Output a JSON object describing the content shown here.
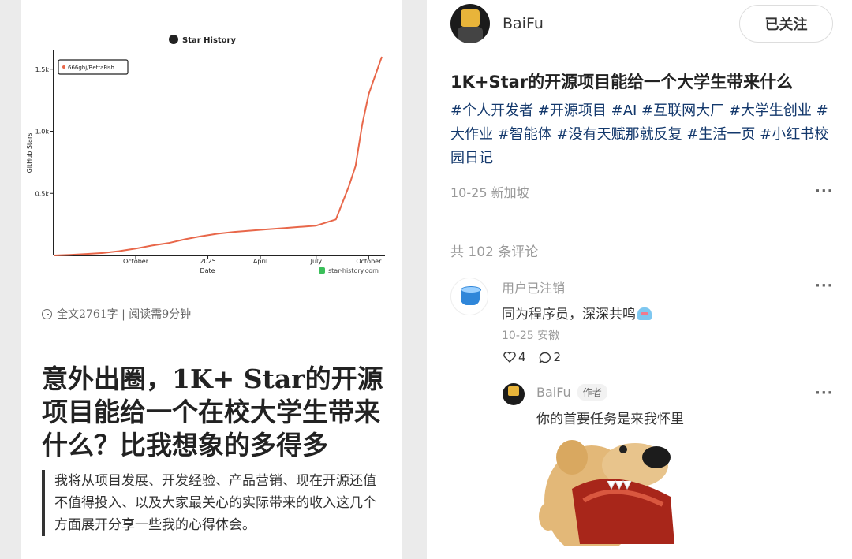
{
  "article": {
    "meta": "全文2761字 | 阅读需9分钟",
    "title": "意外出圈，1K+ Star的开源项目能给一个在校大学生带来什么？比我想象的多得多",
    "quote": "我将从项目发展、开发经验、产品营销、现在开源还值不值得投入、以及大家最关心的实际带来的收入这几个方面展开分享一些我的心得体会。"
  },
  "chart_data": {
    "type": "line",
    "title": "Star History",
    "xlabel": "Date",
    "ylabel": "GitHub Stars",
    "ylim": [
      0,
      1600
    ],
    "x_ticks": [
      "October",
      "2025",
      "April",
      "July",
      "October"
    ],
    "y_ticks": [
      "0.5k",
      "1.0k",
      "1.5k"
    ],
    "series": [
      {
        "name": "666ghj/BettaFish",
        "color": "#e8674a",
        "points": [
          [
            0.0,
            0
          ],
          [
            0.05,
            5
          ],
          [
            0.1,
            12
          ],
          [
            0.15,
            20
          ],
          [
            0.2,
            35
          ],
          [
            0.25,
            55
          ],
          [
            0.3,
            80
          ],
          [
            0.35,
            100
          ],
          [
            0.4,
            130
          ],
          [
            0.45,
            155
          ],
          [
            0.5,
            175
          ],
          [
            0.55,
            190
          ],
          [
            0.6,
            200
          ],
          [
            0.65,
            210
          ],
          [
            0.7,
            220
          ],
          [
            0.75,
            230
          ],
          [
            0.8,
            240
          ],
          [
            0.86,
            290
          ],
          [
            0.9,
            560
          ],
          [
            0.92,
            720
          ],
          [
            0.94,
            1050
          ],
          [
            0.96,
            1300
          ],
          [
            0.98,
            1450
          ],
          [
            1.0,
            1600
          ]
        ]
      }
    ],
    "watermark": "star-history.com",
    "legend_position": "top-left"
  },
  "post": {
    "author": "BaiFu",
    "follow_label": "已关注",
    "title": "1K+Star的开源项目能给一个大学生带来什么",
    "tags": "#个人开发者 #开源项目 #AI #互联网大厂 #大学生创业 #大作业 #智能体 #没有天赋那就反复 #生活一页 #小红书校园日记",
    "meta": "10-25 新加坡",
    "comments_total": "共 102 条评论"
  },
  "comment": {
    "user": "用户已注销",
    "text": "同为程序员，深深共鸣",
    "meta": "10-25 安徽",
    "likes": "4",
    "replies": "2"
  },
  "reply": {
    "user": "BaiFu",
    "badge": "作者",
    "text": "你的首要任务是来我怀里"
  },
  "more_label": "···"
}
